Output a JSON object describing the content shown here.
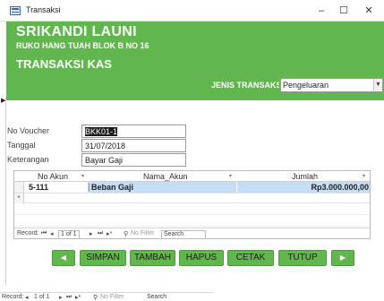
{
  "window": {
    "title": "Transaksi",
    "minimize": "–",
    "maximize": "☐",
    "close": "✕"
  },
  "header": {
    "company": "SRIKANDI LAUNI",
    "address": "RUKO HANG TUAH BLOK B NO 16",
    "form_title": "TRANSAKSI KAS",
    "jenis_label": "JENIS TRANSAKSI",
    "jenis_value": "Pengeluaran"
  },
  "fields": {
    "voucher_label": "No Voucher",
    "voucher_value": "BKK01-1",
    "tanggal_label": "Tanggal",
    "tanggal_value": "31/07/2018",
    "keterangan_label": "Keterangan",
    "keterangan_value": "Bayar Gaji"
  },
  "datasheet": {
    "columns": [
      "No Akun",
      "Nama_Akun",
      "Jumlah"
    ],
    "rows": [
      {
        "no_akun": "5-111",
        "nama_akun": "Beban Gaji",
        "jumlah": "Rp3.000.000,00"
      }
    ],
    "new_row_marker": "*",
    "nav": {
      "record_label": "Record:",
      "position": "1 of 1",
      "filter": "No Filter",
      "search": "Search"
    }
  },
  "buttons": {
    "prev": "◀",
    "simpan": "SIMPAN",
    "tambah": "TAMBAH",
    "hapus": "HAPUS",
    "cetak": "CETAK",
    "tutup": "TUTUP",
    "next": "▶"
  },
  "main_nav": {
    "record_label": "Record:",
    "position": "1 of 1",
    "filter": "No Filter",
    "search": "Search"
  },
  "colors": {
    "header_green": "#61b64e",
    "selection_blue": "#c6def5"
  }
}
